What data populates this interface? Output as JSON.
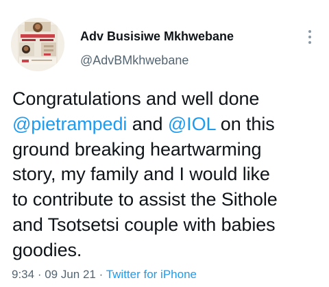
{
  "author": {
    "display_name": "Adv Busisiwe Mkhwebane",
    "handle": "@AdvBMkhwebane"
  },
  "tweet": {
    "lines": [
      {
        "segments": [
          {
            "text": "Congratulations and well done",
            "type": "text"
          }
        ]
      },
      {
        "segments": [
          {
            "text": "@pietrampedi",
            "type": "mention"
          },
          {
            "text": " and ",
            "type": "text"
          },
          {
            "text": "@IOL",
            "type": "mention"
          },
          {
            "text": " on this",
            "type": "text"
          }
        ]
      },
      {
        "segments": [
          {
            "text": "ground breaking heartwarming",
            "type": "text"
          }
        ]
      },
      {
        "segments": [
          {
            "text": "story, my family and I would like",
            "type": "text"
          }
        ]
      },
      {
        "segments": [
          {
            "text": "to contribute to assist the Sithole",
            "type": "text"
          }
        ]
      },
      {
        "segments": [
          {
            "text": "and Tsotsetsi couple with babies",
            "type": "text"
          }
        ]
      },
      {
        "segments": [
          {
            "text": "goodies.",
            "type": "text"
          }
        ]
      }
    ]
  },
  "meta": {
    "time": "9:34",
    "separator": " · ",
    "date": "09 Jun 21",
    "source": "Twitter for iPhone"
  },
  "colors": {
    "link": "#1d9bf0",
    "secondary_text": "#536471",
    "primary_text": "#0f1419"
  },
  "icons": {
    "more": "vertical-ellipsis-icon"
  }
}
